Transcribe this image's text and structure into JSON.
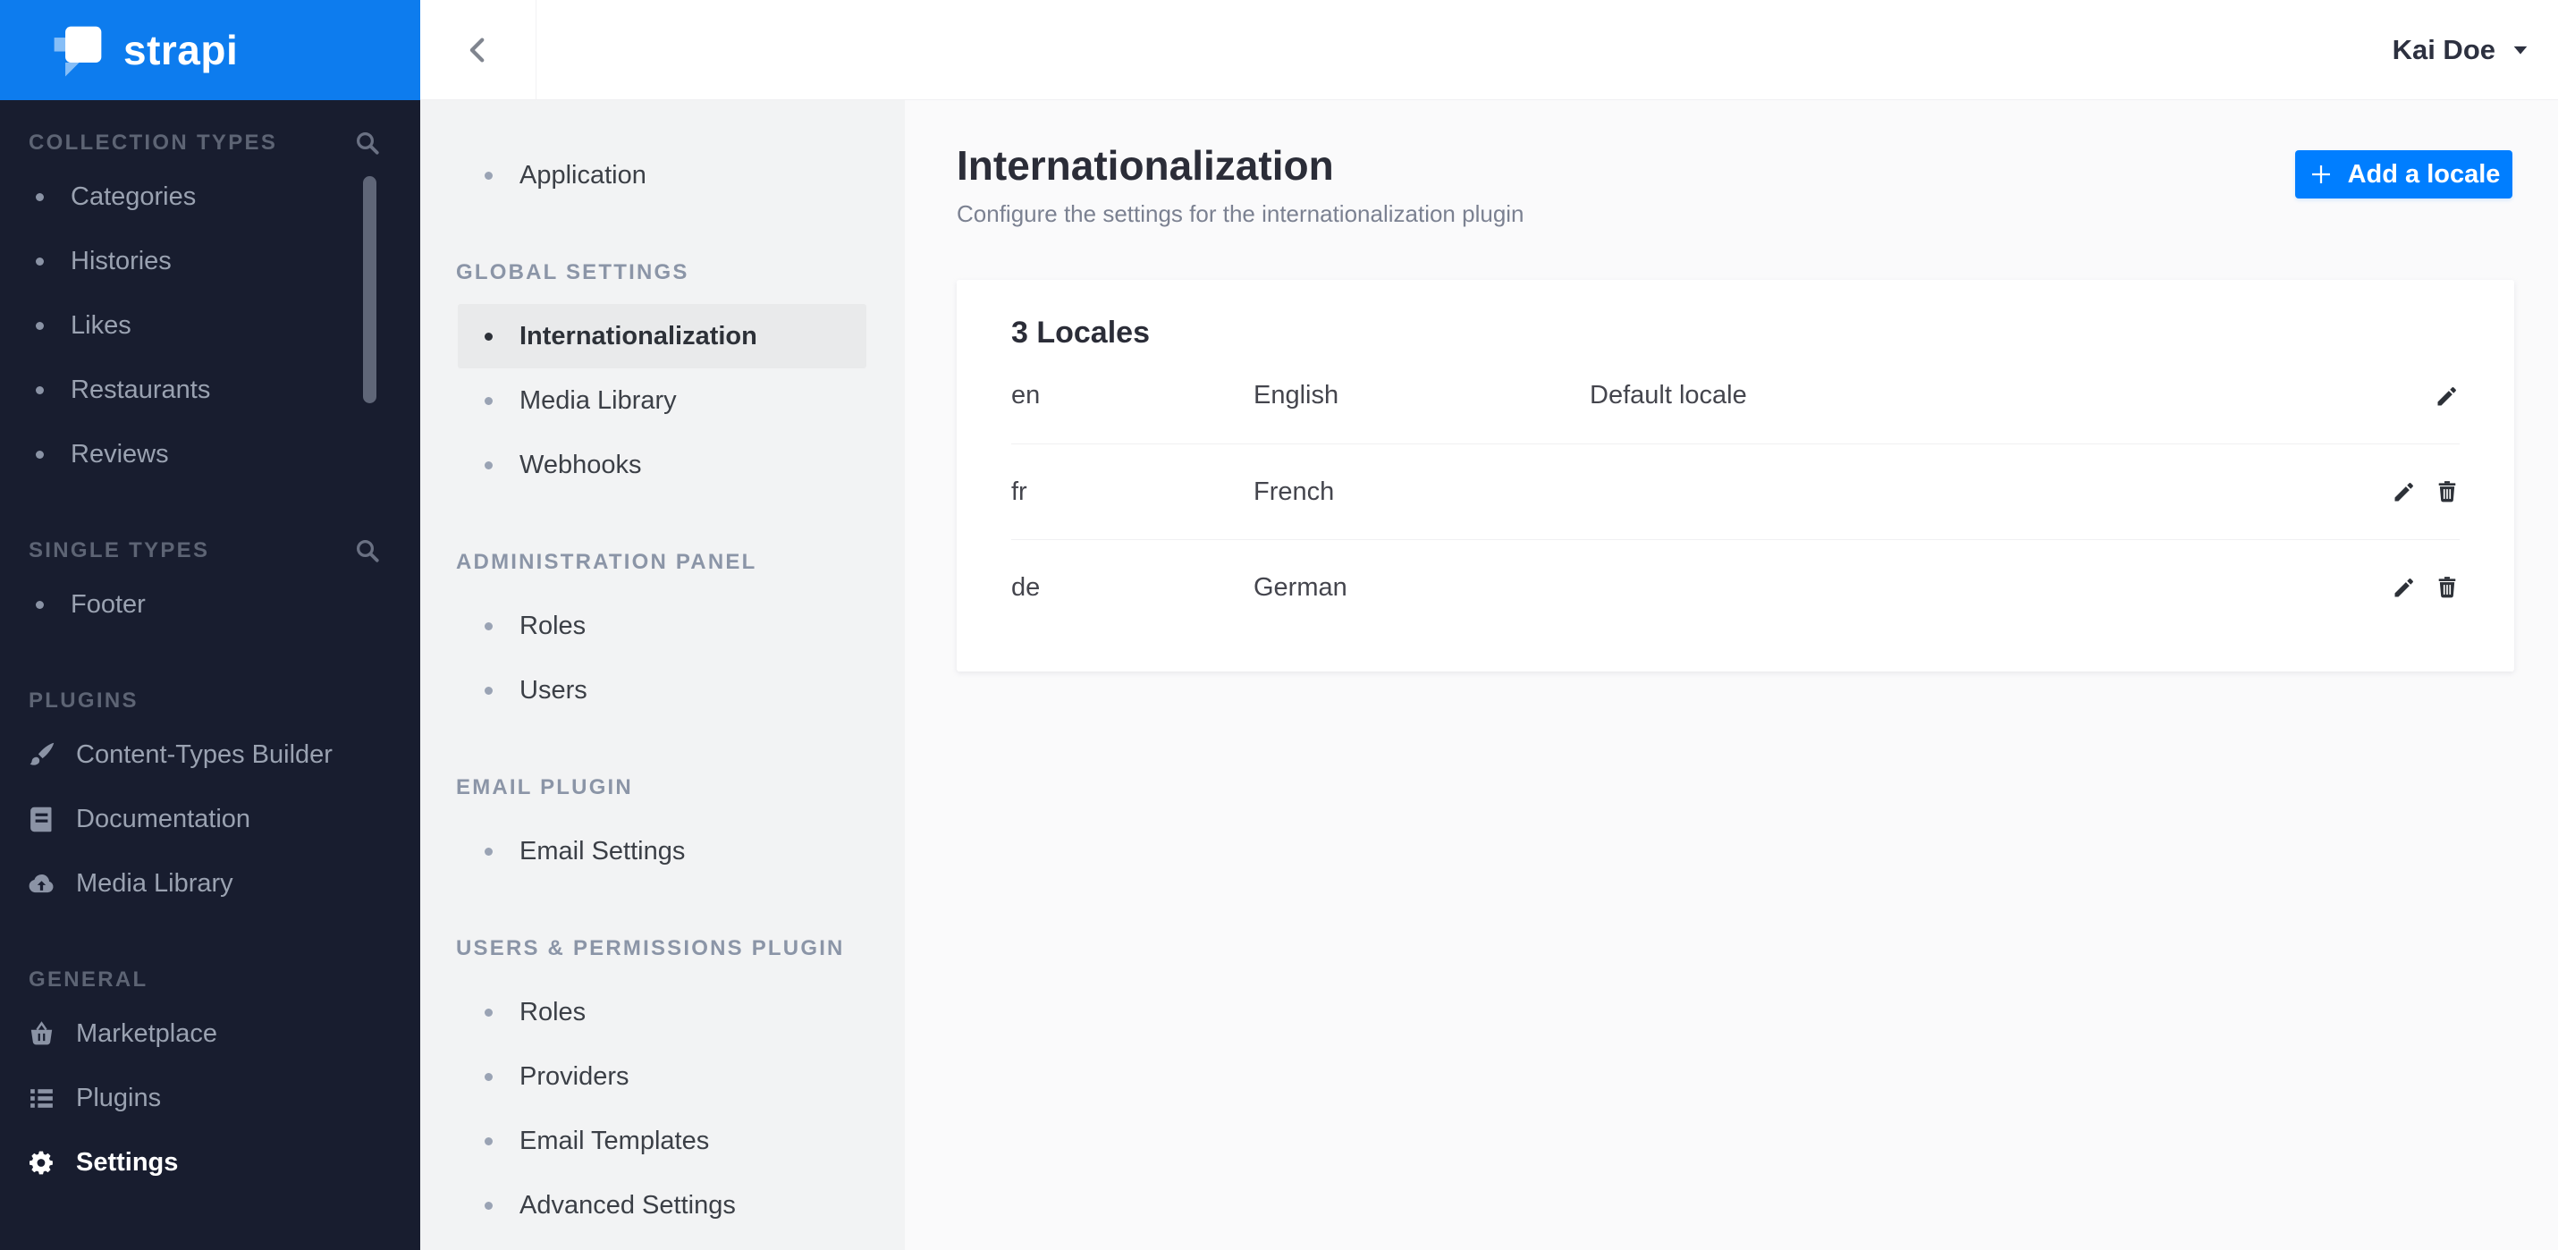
{
  "brand": {
    "name": "strapi",
    "accent_color": "#007eff",
    "sidebar_color": "#181d2f"
  },
  "topbar": {
    "user_name": "Kai Doe"
  },
  "primary_sidebar": {
    "sections": [
      {
        "label": "COLLECTION TYPES",
        "items": [
          "Categories",
          "Histories",
          "Likes",
          "Restaurants",
          "Reviews"
        ]
      },
      {
        "label": "SINGLE TYPES",
        "items": [
          "Footer"
        ]
      },
      {
        "label": "PLUGINS",
        "items": [
          "Content-Types Builder",
          "Documentation",
          "Media Library"
        ]
      },
      {
        "label": "GENERAL",
        "items": [
          "Marketplace",
          "Plugins",
          "Settings"
        ]
      }
    ],
    "active_item": "Settings"
  },
  "secondary_sidebar": {
    "items_top": [
      "Application"
    ],
    "groups": [
      {
        "header": "GLOBAL SETTINGS",
        "items": [
          "Internationalization",
          "Media Library",
          "Webhooks"
        ]
      },
      {
        "header": "ADMINISTRATION PANEL",
        "items": [
          "Roles",
          "Users"
        ]
      },
      {
        "header": "EMAIL PLUGIN",
        "items": [
          "Email Settings"
        ]
      },
      {
        "header": "USERS & PERMISSIONS PLUGIN",
        "items": [
          "Roles",
          "Providers",
          "Email Templates",
          "Advanced Settings"
        ]
      }
    ],
    "active_item": "Internationalization"
  },
  "main": {
    "title": "Internationalization",
    "subtitle": "Configure the settings for the internationalization plugin",
    "add_button_label": "Add a locale",
    "locales_panel": {
      "title": "3 Locales",
      "rows": [
        {
          "code": "en",
          "name": "English",
          "note": "Default locale"
        },
        {
          "code": "fr",
          "name": "French",
          "note": ""
        },
        {
          "code": "de",
          "name": "German",
          "note": ""
        }
      ]
    }
  }
}
